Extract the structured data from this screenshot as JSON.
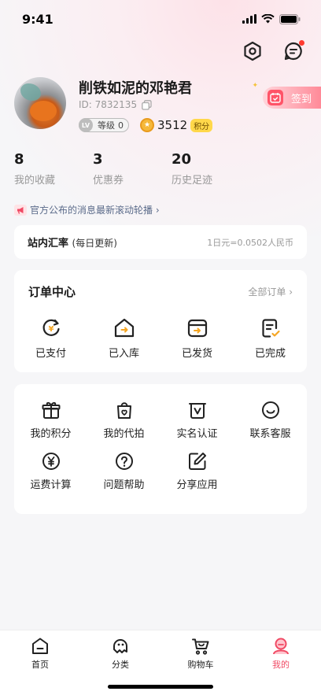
{
  "status": {
    "time": "9:41"
  },
  "profile": {
    "username": "削铁如泥的邓艳君",
    "user_id": "ID: 7832135",
    "level_badge": "LV",
    "level_text": "等级",
    "level_value": "0",
    "points": "3512",
    "points_tag": "积分",
    "checkin_label": "签到"
  },
  "stats": [
    {
      "value": "8",
      "label": "我的收藏"
    },
    {
      "value": "3",
      "label": "优惠券"
    },
    {
      "value": "20",
      "label": "历史足迹"
    }
  ],
  "announcement": "官方公布的消息最新滚动轮播 ›",
  "exchange": {
    "title": "站内汇率",
    "subtitle": "(每日更新)",
    "value": "1日元=0.0502人民币"
  },
  "orders": {
    "title": "订单中心",
    "all_label": "全部订单 ›",
    "items": [
      {
        "label": "已支付",
        "icon": "paid-icon"
      },
      {
        "label": "已入库",
        "icon": "warehouse-icon"
      },
      {
        "label": "已发货",
        "icon": "shipped-icon"
      },
      {
        "label": "已完成",
        "icon": "completed-icon"
      }
    ]
  },
  "tools": [
    {
      "label": "我的积分",
      "icon": "gift-icon"
    },
    {
      "label": "我的代拍",
      "icon": "bag-icon"
    },
    {
      "label": "实名认证",
      "icon": "id-card-icon"
    },
    {
      "label": "联系客服",
      "icon": "chat-smile-icon"
    },
    {
      "label": "运费计算",
      "icon": "yen-circle-icon"
    },
    {
      "label": "问题帮助",
      "icon": "question-icon"
    },
    {
      "label": "分享应用",
      "icon": "share-edit-icon"
    }
  ],
  "tabbar": [
    {
      "label": "首页",
      "icon": "home-icon",
      "active": false
    },
    {
      "label": "分类",
      "icon": "category-icon",
      "active": false
    },
    {
      "label": "购物车",
      "icon": "cart-icon",
      "active": false
    },
    {
      "label": "我的",
      "icon": "profile-icon",
      "active": true
    }
  ],
  "colors": {
    "accent": "#f04a64",
    "order_accent": "#f5a623",
    "coin": "#f5b83a"
  }
}
